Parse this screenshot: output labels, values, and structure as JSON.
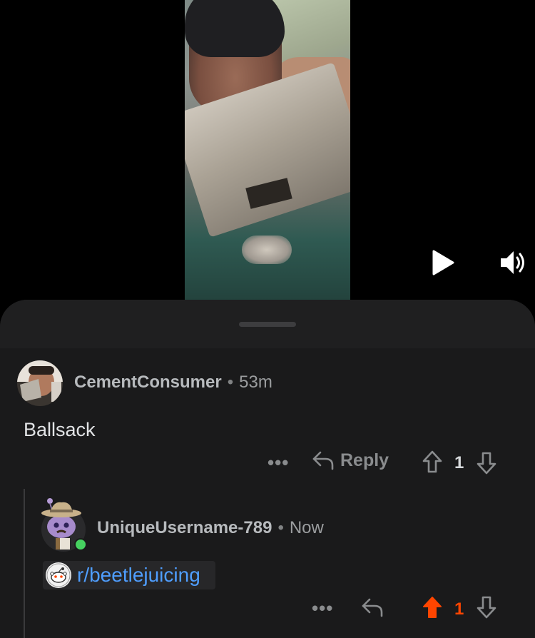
{
  "video": {
    "controls": {
      "play_icon": "play-icon",
      "volume_icon": "volume-icon"
    }
  },
  "comments": [
    {
      "username": "CementConsumer",
      "separator": "•",
      "time": "53m",
      "body": "Ballsack",
      "more_label": "•••",
      "reply_label": "Reply",
      "votes": "1",
      "upvoted": false
    },
    {
      "username": "UniqueUsername-789",
      "separator": "•",
      "time": "Now",
      "body_link": "r/beetlejuicing",
      "more_label": "•••",
      "votes": "1",
      "upvoted": true,
      "online": true
    }
  ],
  "colors": {
    "upvote_active": "#ff4500",
    "link": "#4f9eff",
    "online": "#46d160"
  }
}
